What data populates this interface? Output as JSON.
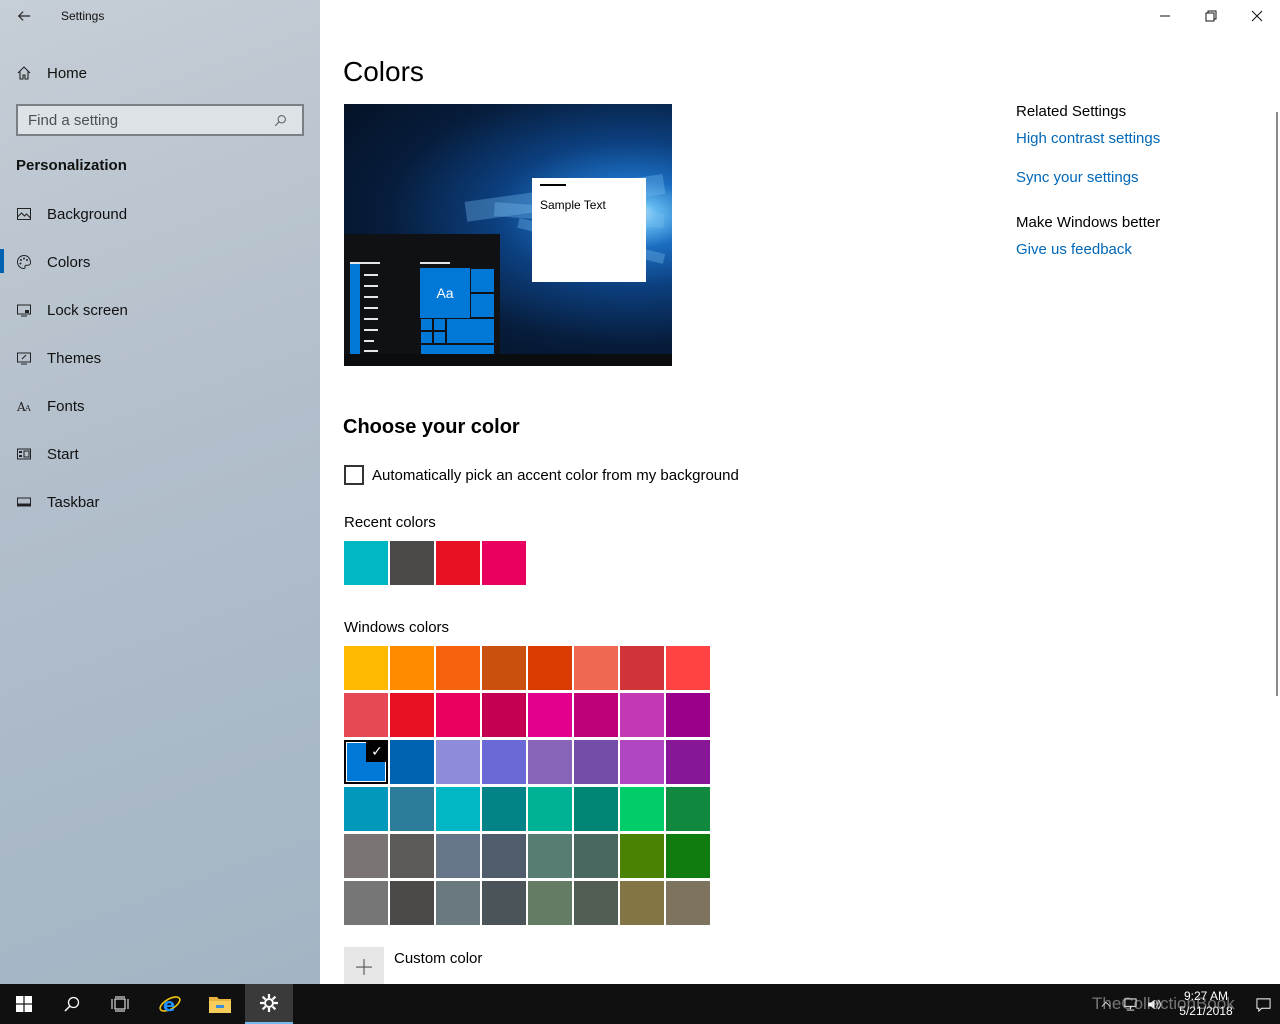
{
  "window": {
    "title": "Settings"
  },
  "sidebar": {
    "home_label": "Home",
    "search_placeholder": "Find a setting",
    "section_title": "Personalization",
    "items": [
      {
        "label": "Background",
        "icon": "picture-icon"
      },
      {
        "label": "Colors",
        "icon": "palette-icon",
        "selected": true
      },
      {
        "label": "Lock screen",
        "icon": "lock-screen-icon"
      },
      {
        "label": "Themes",
        "icon": "brush-icon"
      },
      {
        "label": "Fonts",
        "icon": "font-icon"
      },
      {
        "label": "Start",
        "icon": "start-icon"
      },
      {
        "label": "Taskbar",
        "icon": "taskbar-icon"
      }
    ]
  },
  "main": {
    "title": "Colors",
    "preview": {
      "tile_text": "Aa",
      "sample_text": "Sample Text"
    },
    "choose_heading": "Choose your color",
    "auto_pick_label": "Automatically pick an accent color from my background",
    "auto_pick_checked": false,
    "recent_label": "Recent colors",
    "recent_colors": [
      "#00b7c3",
      "#4c4a48",
      "#e81123",
      "#ea005e"
    ],
    "windows_label": "Windows colors",
    "windows_colors": [
      "#ffb900",
      "#ff8c00",
      "#f7630c",
      "#ca5010",
      "#da3b01",
      "#ef6950",
      "#d13438",
      "#ff4343",
      "#e74856",
      "#e81123",
      "#ea005e",
      "#c30052",
      "#e3008c",
      "#bf0077",
      "#c239b3",
      "#9a0089",
      "#0078d7",
      "#0063b1",
      "#8e8cd8",
      "#6b69d6",
      "#8764b8",
      "#744da9",
      "#b146c2",
      "#881798",
      "#0099bc",
      "#2d7d9a",
      "#00b7c3",
      "#038387",
      "#00b294",
      "#018574",
      "#00cc6a",
      "#10893e",
      "#7a7574",
      "#5d5a58",
      "#68768a",
      "#515c6b",
      "#567c73",
      "#486860",
      "#498205",
      "#107c10",
      "#767676",
      "#4c4a48",
      "#69797e",
      "#4a5459",
      "#647c64",
      "#525e54",
      "#847545",
      "#7e735f"
    ],
    "selected_color": "#0078d7",
    "custom_color_label": "Custom color"
  },
  "related": {
    "heading": "Related Settings",
    "links": [
      "High contrast settings",
      "Sync your settings"
    ],
    "feedback_heading": "Make Windows better",
    "feedback_link": "Give us feedback"
  },
  "taskbar": {
    "time": "9:27 AM",
    "date": "5/21/2018",
    "watermark": "TheCollectionBook",
    "accent": "#76b9ed"
  }
}
